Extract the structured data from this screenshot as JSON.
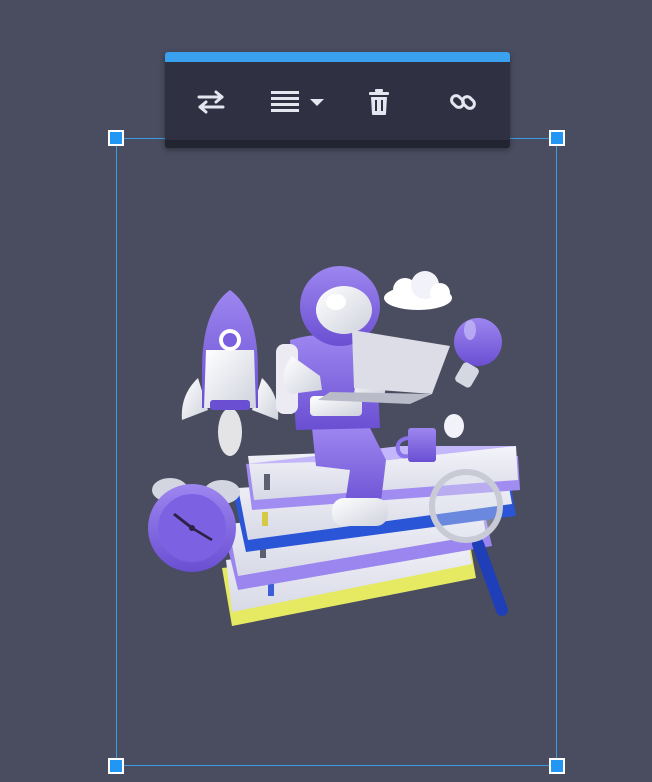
{
  "colors": {
    "canvas": "#4a4d5f",
    "selection": "#3a9be8",
    "handle": "#2196f3",
    "toolbar": "#2f3142",
    "toolbar_accent": "#3aa0f0",
    "icon": "#e4e6f0"
  },
  "toolbar": {
    "items": [
      {
        "icon": "replace-arrows-icon"
      },
      {
        "icon": "align-lines-icon",
        "dropdown": true
      },
      {
        "icon": "trash-icon"
      },
      {
        "icon": "link-icon"
      }
    ]
  },
  "image": {
    "subject": "astronaut-on-books-illustration"
  }
}
